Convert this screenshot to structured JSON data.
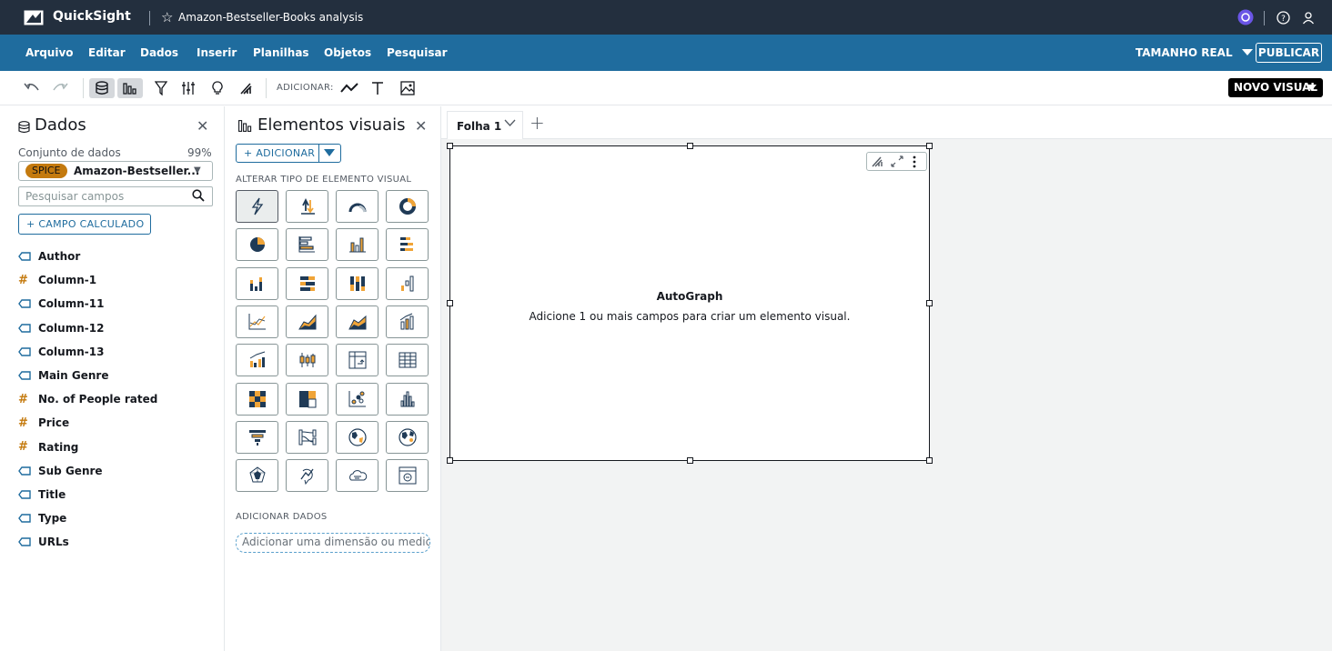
{
  "topbar": {
    "app_name": "QuickSight",
    "analysis_name": "Amazon-Bestseller-Books analysis"
  },
  "menu": {
    "items": [
      "Arquivo",
      "Editar",
      "Dados",
      "Inserir",
      "Planilhas",
      "Objetos",
      "Pesquisar"
    ],
    "size_label": "TAMANHO REAL",
    "publish_label": "PUBLICAR"
  },
  "toolbar": {
    "add_label": "ADICIONAR:",
    "new_visual_label": "NOVO VISUAL"
  },
  "data_pane": {
    "title": "Dados",
    "dataset_label": "Conjunto de dados",
    "dataset_percent": "99%",
    "spice_badge": "SPICE",
    "dataset_name": "Amazon-Bestseller...",
    "search_placeholder": "Pesquisar campos",
    "calc_field_label": "+  CAMPO CALCULADO",
    "fields": [
      {
        "name": "Author",
        "type": "dimension"
      },
      {
        "name": "Column-1",
        "type": "measure"
      },
      {
        "name": "Column-11",
        "type": "dimension"
      },
      {
        "name": "Column-12",
        "type": "dimension"
      },
      {
        "name": "Column-13",
        "type": "dimension"
      },
      {
        "name": "Main Genre",
        "type": "dimension"
      },
      {
        "name": "No. of People rated",
        "type": "measure"
      },
      {
        "name": "Price",
        "type": "measure"
      },
      {
        "name": "Rating",
        "type": "measure"
      },
      {
        "name": "Sub Genre",
        "type": "dimension"
      },
      {
        "name": "Title",
        "type": "dimension"
      },
      {
        "name": "Type",
        "type": "dimension"
      },
      {
        "name": "URLs",
        "type": "dimension"
      }
    ]
  },
  "visuals_pane": {
    "title": "Elementos visuais",
    "add_label": "+ ADICIONAR",
    "change_type_label": "ALTERAR TIPO DE ELEMENTO VISUAL",
    "add_data_label": "ADICIONAR DADOS",
    "dropzone_text": "Adicionar uma dimensão ou medida"
  },
  "sheet": {
    "tab_label": "Folha 1"
  },
  "visual": {
    "title": "AutoGraph",
    "message": "Adicione 1 ou mais campos para criar um elemento visual."
  },
  "colors": {
    "topbar": "#232f3e",
    "menubar": "#1f6c9e",
    "spice": "#c47a0e",
    "measure_icon": "#c47a0e",
    "accent": "#1f6c9e"
  }
}
